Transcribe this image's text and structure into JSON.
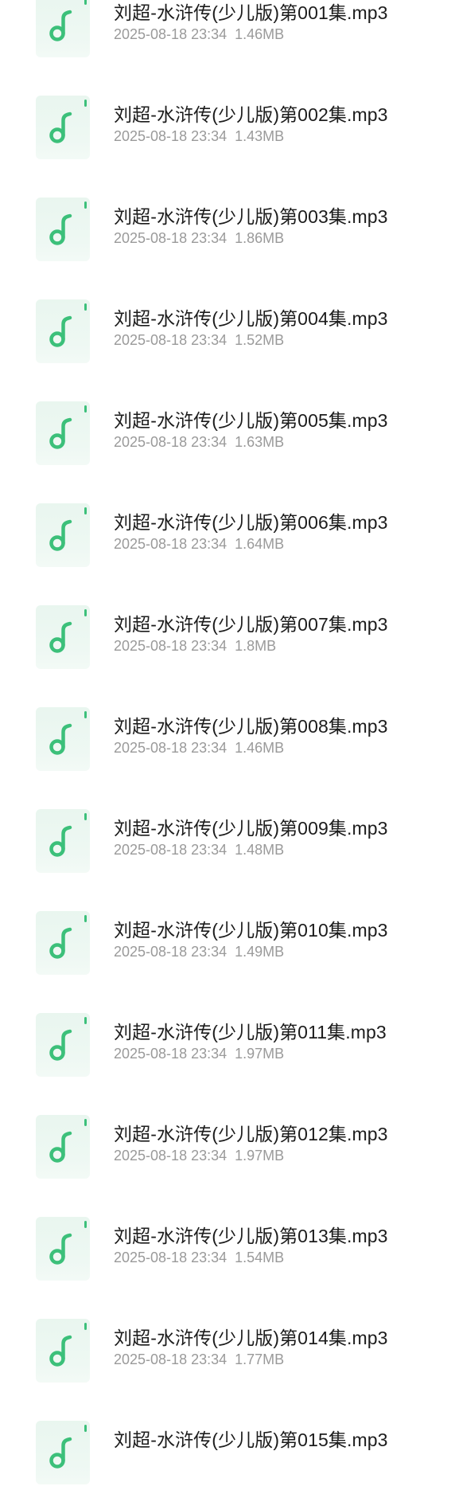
{
  "colors": {
    "icon_accent": "#3cc07a",
    "icon_background": "#eaf6ef",
    "name_text": "#1c1c1c",
    "meta_text": "#9a9a9a"
  },
  "icon_name": "music-note-icon",
  "files": [
    {
      "name": "刘超-水浒传(少儿版)第001集.mp3",
      "date": "2025-08-18 23:34",
      "size": "1.46MB"
    },
    {
      "name": "刘超-水浒传(少儿版)第002集.mp3",
      "date": "2025-08-18 23:34",
      "size": "1.43MB"
    },
    {
      "name": "刘超-水浒传(少儿版)第003集.mp3",
      "date": "2025-08-18 23:34",
      "size": "1.86MB"
    },
    {
      "name": "刘超-水浒传(少儿版)第004集.mp3",
      "date": "2025-08-18 23:34",
      "size": "1.52MB"
    },
    {
      "name": "刘超-水浒传(少儿版)第005集.mp3",
      "date": "2025-08-18 23:34",
      "size": "1.63MB"
    },
    {
      "name": "刘超-水浒传(少儿版)第006集.mp3",
      "date": "2025-08-18 23:34",
      "size": "1.64MB"
    },
    {
      "name": "刘超-水浒传(少儿版)第007集.mp3",
      "date": "2025-08-18 23:34",
      "size": "1.8MB"
    },
    {
      "name": "刘超-水浒传(少儿版)第008集.mp3",
      "date": "2025-08-18 23:34",
      "size": "1.46MB"
    },
    {
      "name": "刘超-水浒传(少儿版)第009集.mp3",
      "date": "2025-08-18 23:34",
      "size": "1.48MB"
    },
    {
      "name": "刘超-水浒传(少儿版)第010集.mp3",
      "date": "2025-08-18 23:34",
      "size": "1.49MB"
    },
    {
      "name": "刘超-水浒传(少儿版)第011集.mp3",
      "date": "2025-08-18 23:34",
      "size": "1.97MB"
    },
    {
      "name": "刘超-水浒传(少儿版)第012集.mp3",
      "date": "2025-08-18 23:34",
      "size": "1.97MB"
    },
    {
      "name": "刘超-水浒传(少儿版)第013集.mp3",
      "date": "2025-08-18 23:34",
      "size": "1.54MB"
    },
    {
      "name": "刘超-水浒传(少儿版)第014集.mp3",
      "date": "2025-08-18 23:34",
      "size": "1.77MB"
    },
    {
      "name": "刘超-水浒传(少儿版)第015集.mp3",
      "date": "",
      "size": ""
    }
  ]
}
